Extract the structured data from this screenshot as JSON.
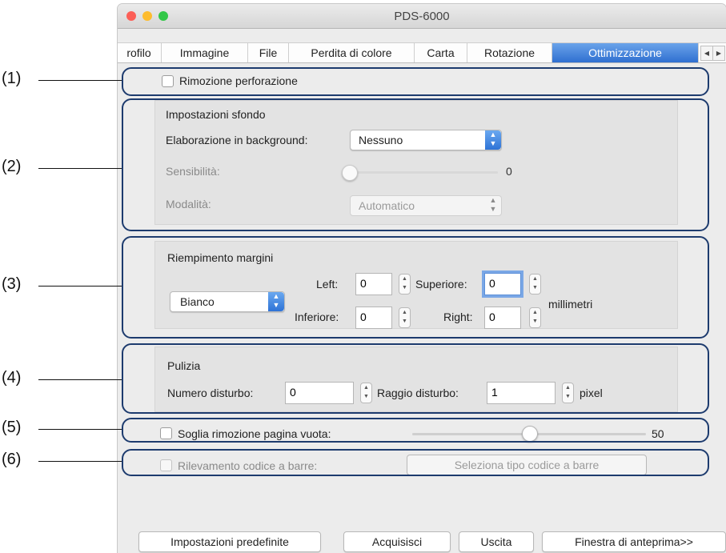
{
  "window": {
    "title": "PDS-6000"
  },
  "tabs": [
    {
      "label": "rofilo"
    },
    {
      "label": "Immagine"
    },
    {
      "label": "File"
    },
    {
      "label": "Perdita di colore"
    },
    {
      "label": "Carta"
    },
    {
      "label": "Rotazione"
    },
    {
      "label": "Ottimizzazione"
    }
  ],
  "callouts": [
    "(1)",
    "(2)",
    "(3)",
    "(4)",
    "(5)",
    "(6)"
  ],
  "punch": {
    "label": "Rimozione perforazione",
    "checked": false
  },
  "background": {
    "title": "Impostazioni sfondo",
    "processing_label": "Elaborazione in background:",
    "processing_value": "Nessuno",
    "sensitivity_label": "Sensibilità:",
    "sensitivity_value": "0",
    "mode_label": "Modalità:",
    "mode_value": "Automatico"
  },
  "margins": {
    "title": "Riempimento margini",
    "fill_value": "Bianco",
    "left_label": "Left:",
    "left_value": "0",
    "top_label": "Superiore:",
    "top_value": "0",
    "bottom_label": "Inferiore:",
    "bottom_value": "0",
    "right_label": "Right:",
    "right_value": "0",
    "unit": "millimetri"
  },
  "cleanup": {
    "title": "Pulizia",
    "noise_count_label": "Numero disturbo:",
    "noise_count_value": "0",
    "noise_radius_label": "Raggio disturbo:",
    "noise_radius_value": "1",
    "unit": "pixel"
  },
  "blank_page": {
    "label": "Soglia rimozione pagina vuota:",
    "checked": false,
    "value": "50",
    "level_fraction": 0.5
  },
  "barcode": {
    "label": "Rilevamento codice a barre:",
    "button": "Seleziona tipo codice a barre"
  },
  "footer": {
    "defaults": "Impostazioni predefinite",
    "acquire": "Acquisisci",
    "exit": "Uscita",
    "preview": "Finestra di anteprima>>"
  },
  "colors": {
    "accent": "#3a7ad0",
    "callout_border": "#1d3b6e"
  }
}
